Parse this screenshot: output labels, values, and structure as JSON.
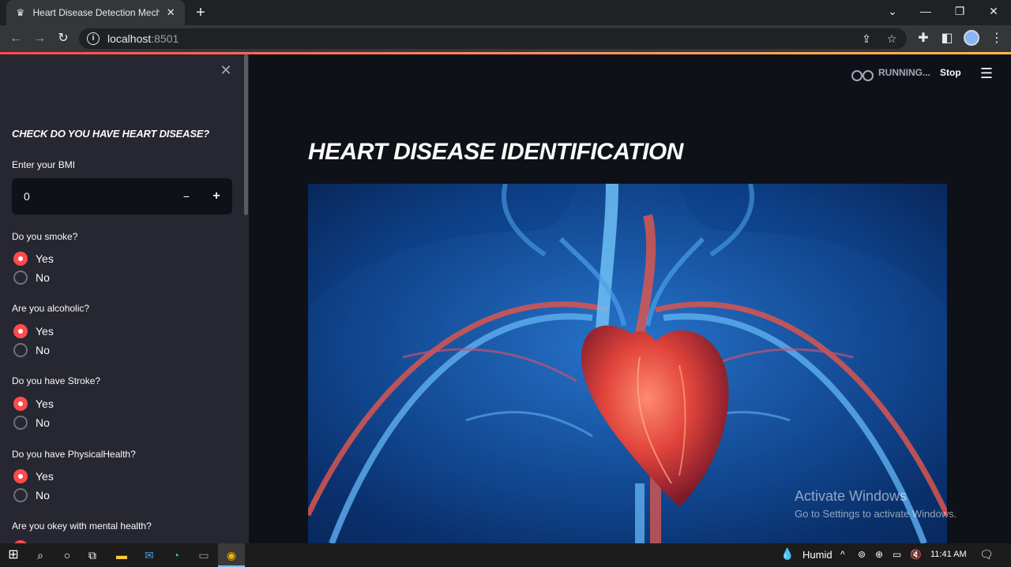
{
  "browser": {
    "tab_title": "Heart Disease Detection Mechine",
    "new_tab": "+",
    "url_host": "localhost",
    "url_port": ":8501"
  },
  "sidebar": {
    "heading": "CHECK DO YOU HAVE HEART DISEASE?",
    "bmi": {
      "label": "Enter your BMI",
      "value": "0",
      "minus": "−",
      "plus": "+"
    },
    "questions": [
      {
        "label": "Do you smoke?",
        "options": [
          "Yes",
          "No"
        ],
        "selected": "Yes"
      },
      {
        "label": "Are you alcoholic?",
        "options": [
          "Yes",
          "No"
        ],
        "selected": "Yes"
      },
      {
        "label": "Do you have Stroke?",
        "options": [
          "Yes",
          "No"
        ],
        "selected": "Yes"
      },
      {
        "label": "Do you have PhysicalHealth?",
        "options": [
          "Yes",
          "No"
        ],
        "selected": "Yes"
      },
      {
        "label": "Are you okey with mental health?"
      }
    ]
  },
  "header": {
    "status": "RUNNING...",
    "stop": "Stop"
  },
  "main": {
    "title": "HEART DISEASE IDENTIFICATION"
  },
  "watermark": {
    "line1": "Activate Windows",
    "line2": "Go to Settings to activate Windows."
  },
  "taskbar": {
    "weather": "Humid",
    "time": "11:41 AM"
  },
  "colors": {
    "accent": "#ff4b4b",
    "sidebar_bg": "#262730",
    "main_bg": "#0e1117"
  }
}
